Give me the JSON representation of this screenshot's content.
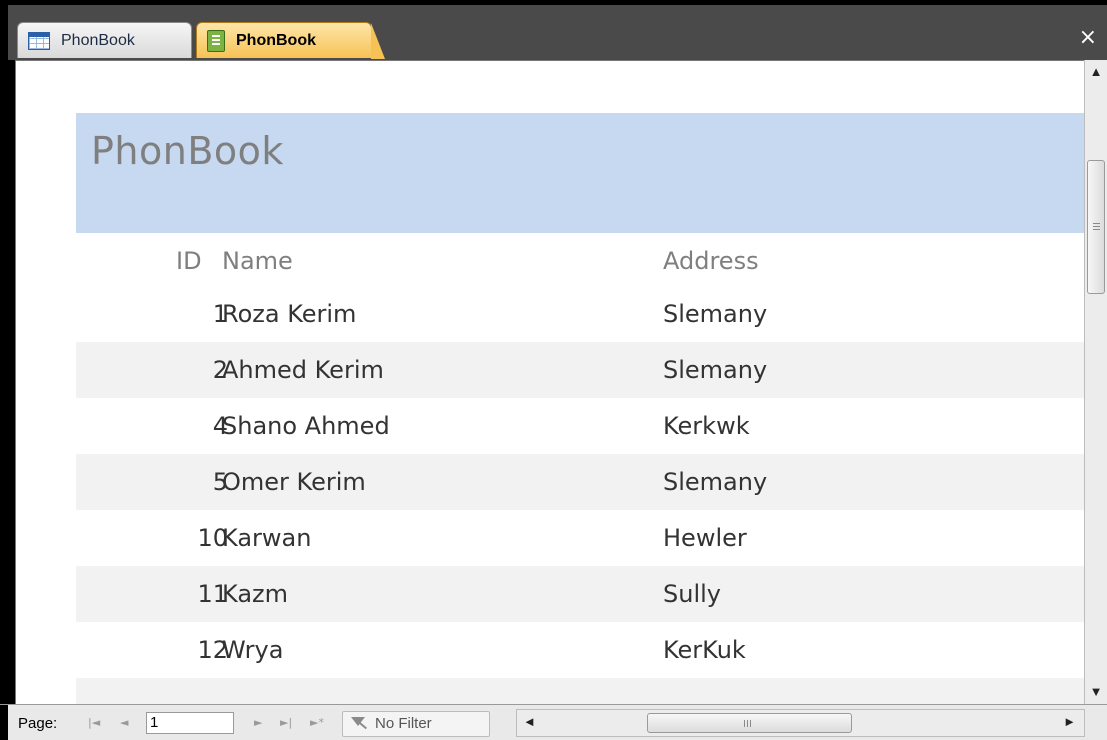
{
  "tabs": [
    {
      "label": "PhonBook",
      "icon": "table-icon",
      "active": false
    },
    {
      "label": "PhonBook",
      "icon": "report-icon",
      "active": true
    }
  ],
  "close_label": "×",
  "report": {
    "title": "PhonBook",
    "header_color": "#c6d9f0",
    "columns": {
      "id": "ID",
      "name": "Name",
      "address": "Address"
    },
    "rows": [
      {
        "id": "1",
        "name": "Roza Kerim",
        "address": "Slemany"
      },
      {
        "id": "2",
        "name": "Ahmed Kerim",
        "address": "Slemany"
      },
      {
        "id": "4",
        "name": "Shano Ahmed",
        "address": "Kerkwk"
      },
      {
        "id": "5",
        "name": "Omer Kerim",
        "address": "Slemany"
      },
      {
        "id": "10",
        "name": "Karwan",
        "address": "Hewler"
      },
      {
        "id": "11",
        "name": "Kazm",
        "address": "Sully"
      },
      {
        "id": "12",
        "name": "Wrya",
        "address": "KerKuk"
      }
    ]
  },
  "navigation": {
    "page_label": "Page:",
    "page_value": "1",
    "filter_label": "No Filter"
  }
}
